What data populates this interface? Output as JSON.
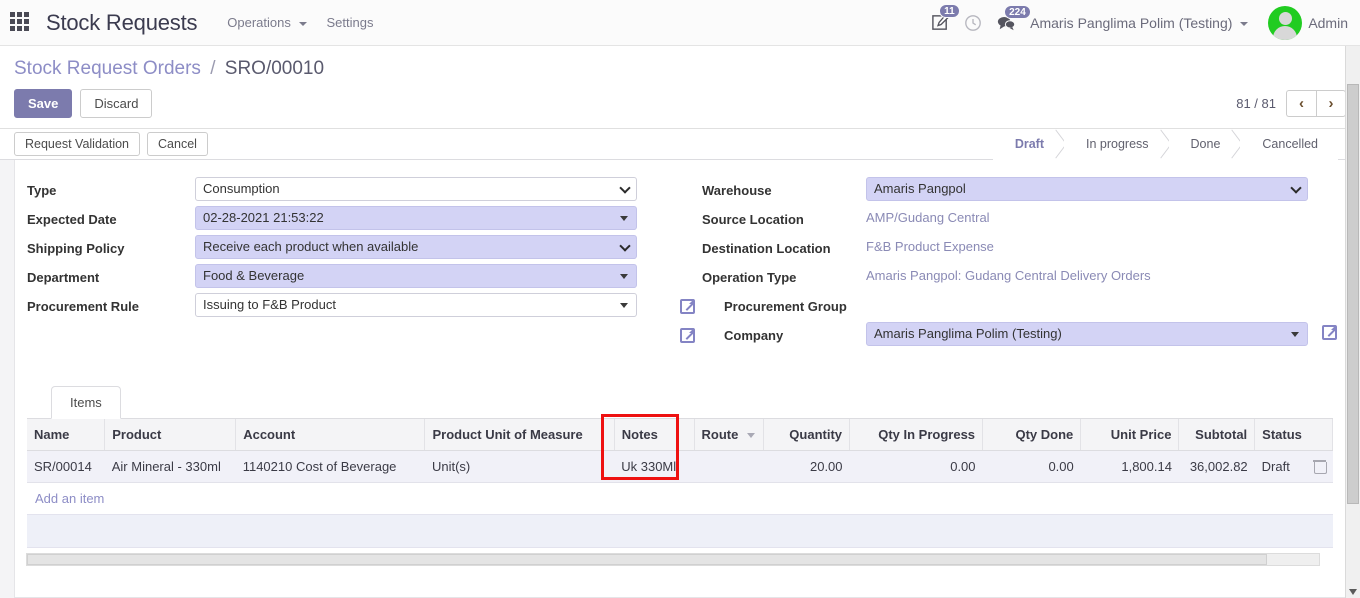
{
  "navbar": {
    "apps_icon": "apps-grid-icon",
    "brand": "Stock Requests",
    "menus": [
      {
        "label": "Operations",
        "has_caret": true
      },
      {
        "label": "Settings",
        "has_caret": false
      }
    ],
    "activity_badge": "11",
    "clock_icon": "clock-icon",
    "messages_badge": "224",
    "user_menu": "Amaris Panglima Polim (Testing)",
    "admin_label": "Admin",
    "avatar_color": "#21cc21"
  },
  "breadcrumb": {
    "parent": "Stock Request Orders",
    "separator": "/",
    "current": "SRO/00010"
  },
  "actions": {
    "save": "Save",
    "discard": "Discard",
    "request_validation": "Request Validation",
    "cancel": "Cancel"
  },
  "pager": {
    "text": "81 / 81",
    "prev": "‹",
    "next": "›"
  },
  "statusbar": {
    "active": "Draft",
    "steps": [
      "Draft",
      "In progress",
      "Done",
      "Cancelled"
    ]
  },
  "form": {
    "left": [
      {
        "label": "Type",
        "value": "Consumption",
        "highlight": false,
        "caret": "chevron"
      },
      {
        "label": "Expected Date",
        "value": "02-28-2021 21:53:22",
        "highlight": true,
        "caret": "triangle"
      },
      {
        "label": "Shipping Policy",
        "value": "Receive each product when available",
        "highlight": true,
        "caret": "chevron"
      },
      {
        "label": "Department",
        "value": "Food & Beverage",
        "highlight": true,
        "caret": "triangle"
      },
      {
        "label": "Procurement Rule",
        "value": "Issuing to F&B Product",
        "highlight": false,
        "caret": "triangle"
      }
    ],
    "right": [
      {
        "label": "Warehouse",
        "value": "Amaris Pangpol",
        "type": "select",
        "highlight": true,
        "caret": "chevron",
        "ext_left": false,
        "ext_after": false
      },
      {
        "label": "Source Location",
        "value": "AMP/Gudang Central",
        "type": "readonly",
        "highlight": false,
        "ext_left": false,
        "ext_after": false
      },
      {
        "label": "Destination Location",
        "value": "F&B Product Expense",
        "type": "readonly",
        "highlight": false,
        "ext_left": false,
        "ext_after": false
      },
      {
        "label": "Operation Type",
        "value": "Amaris Pangpol: Gudang Central Delivery Orders",
        "type": "readonly",
        "highlight": false,
        "ext_left": false,
        "ext_after": false
      },
      {
        "label": "Procurement Group",
        "value": "",
        "type": "blank",
        "highlight": false,
        "ext_left": true,
        "ext_after": false
      },
      {
        "label": "Company",
        "value": "Amaris Panglima Polim (Testing)",
        "type": "select",
        "highlight": true,
        "caret": "triangle",
        "ext_left": true,
        "ext_after": true
      }
    ]
  },
  "notebook": {
    "tabs": [
      {
        "label": "Items",
        "active": true
      }
    ]
  },
  "items_table": {
    "columns": [
      {
        "label": "Name",
        "align": "left",
        "caret": false
      },
      {
        "label": "Product",
        "align": "left",
        "caret": false
      },
      {
        "label": "Account",
        "align": "left",
        "caret": false
      },
      {
        "label": "Product Unit of Measure",
        "align": "left",
        "caret": false
      },
      {
        "label": "Notes",
        "align": "left",
        "caret": false
      },
      {
        "label": "Route",
        "align": "left",
        "caret": true
      },
      {
        "label": "Quantity",
        "align": "right",
        "caret": false
      },
      {
        "label": "Qty In Progress",
        "align": "right",
        "caret": false
      },
      {
        "label": "Qty Done",
        "align": "right",
        "caret": false
      },
      {
        "label": "Unit Price",
        "align": "right",
        "caret": false
      },
      {
        "label": "Subtotal",
        "align": "right",
        "caret": false
      },
      {
        "label": "Status",
        "align": "left",
        "caret": false
      }
    ],
    "rows": [
      {
        "name": "SR/00014",
        "product": "Air Mineral - 330ml",
        "account": "1140210 Cost of Beverage",
        "uom": "Unit(s)",
        "notes": "Uk 330Ml",
        "route": "",
        "quantity": "20.00",
        "qty_in_progress": "0.00",
        "qty_done": "0.00",
        "unit_price": "1,800.14",
        "subtotal": "36,002.82",
        "status": "Draft",
        "delete_icon": "trash-icon"
      }
    ],
    "add_item": "Add an item"
  },
  "annotation": {
    "color": "#ee1111",
    "target": "Notes"
  }
}
